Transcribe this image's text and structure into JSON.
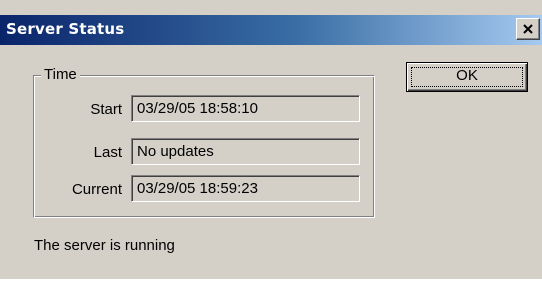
{
  "window": {
    "title": "Server Status",
    "close_icon": "close-icon"
  },
  "time_group": {
    "legend": "Time",
    "rows": [
      {
        "label": "Start",
        "value": "03/29/05 18:58:10"
      },
      {
        "label": "Last",
        "value": "No updates"
      },
      {
        "label": "Current",
        "value": "03/29/05 18:59:23"
      }
    ]
  },
  "buttons": {
    "ok_label": "OK"
  },
  "status": {
    "text": "The server is running"
  },
  "colors": {
    "dialog_face": "#d4d0c8",
    "titlebar_start": "#0a246a",
    "titlebar_end": "#a6caf0"
  }
}
